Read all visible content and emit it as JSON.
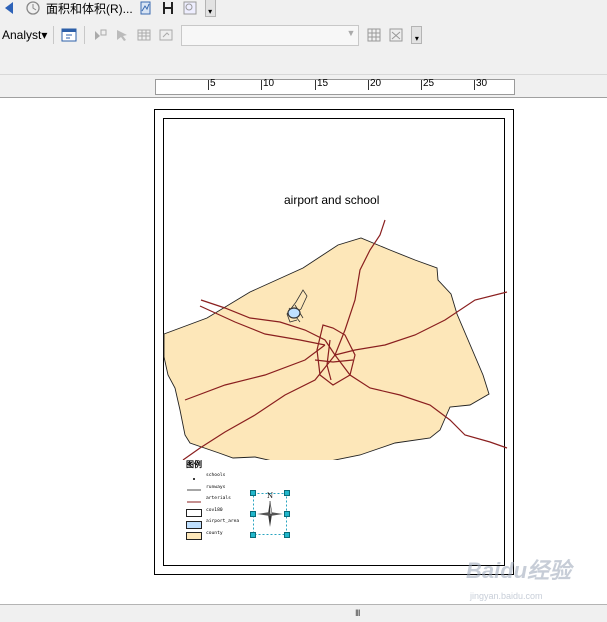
{
  "toolbar": {
    "row1": {
      "menu_label": "面积和体积(R)..."
    },
    "row2": {
      "analyst_label": "Analyst",
      "analyst_arrow": "▾"
    }
  },
  "ruler": {
    "labels": [
      "5",
      "10",
      "15",
      "20",
      "25",
      "30"
    ]
  },
  "map": {
    "title": "airport and school",
    "colors": {
      "county_fill": "#fde7b9",
      "road": "#8a1f1f",
      "airport_fill": "#bfe0ff"
    }
  },
  "legend": {
    "title": "图例",
    "items": [
      "schools",
      "runways",
      "arterials",
      "cov180",
      "airport_area",
      "county"
    ]
  },
  "north_arrow": {
    "letter": "N"
  },
  "statusbar": {
    "grip": "III"
  },
  "watermark": {
    "brand": "Baidu经验",
    "url": "jingyan.baidu.com"
  }
}
